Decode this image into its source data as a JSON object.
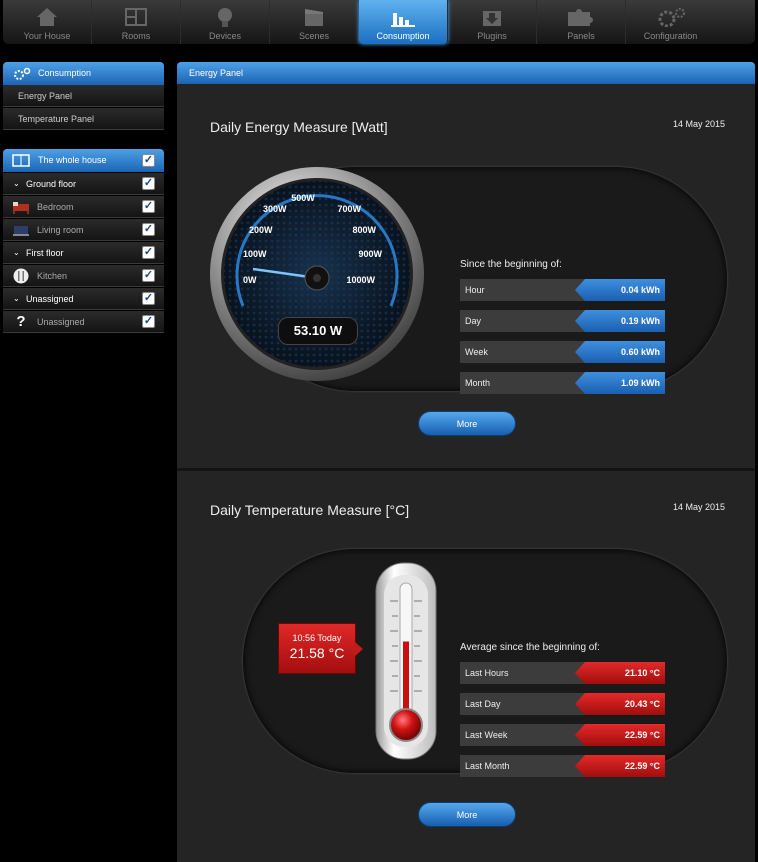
{
  "nav": {
    "tabs": [
      {
        "label": "Your House",
        "icon": "house-icon"
      },
      {
        "label": "Rooms",
        "icon": "rooms-icon"
      },
      {
        "label": "Devices",
        "icon": "bulb-icon"
      },
      {
        "label": "Scenes",
        "icon": "clapper-icon"
      },
      {
        "label": "Consumption",
        "icon": "bar-chart-icon",
        "active": true
      },
      {
        "label": "Plugins",
        "icon": "plugin-download-icon"
      },
      {
        "label": "Panels",
        "icon": "puzzle-icon"
      },
      {
        "label": "Configuration",
        "icon": "gears-icon"
      }
    ]
  },
  "sidebar": {
    "consumption": {
      "header": "Consumption",
      "items": [
        "Energy Panel",
        "Temperature Panel"
      ]
    },
    "house": {
      "header": "The whole house",
      "rows": [
        {
          "label": "Ground floor",
          "type": "group"
        },
        {
          "label": "Bedroom",
          "type": "room",
          "icon": "bed-icon"
        },
        {
          "label": "Living room",
          "type": "room",
          "icon": "sofa-icon"
        },
        {
          "label": "First floor",
          "type": "group"
        },
        {
          "label": "Kitchen",
          "type": "room",
          "icon": "cutlery-icon"
        },
        {
          "label": "Unassigned",
          "type": "group"
        },
        {
          "label": "Unassigned",
          "type": "room",
          "icon": "question-icon"
        }
      ]
    }
  },
  "main": {
    "header": "Energy Panel",
    "energy": {
      "title": "Daily Energy Measure [Watt]",
      "date": "14 May 2015",
      "gauge": {
        "labels": [
          "0W",
          "100W",
          "200W",
          "300W",
          "500W",
          "700W",
          "800W",
          "900W",
          "1000W"
        ],
        "reading": "53.10 W",
        "value_w": 53.1
      },
      "subtitle": "Since the beginning of:",
      "rows": [
        {
          "label": "Hour",
          "value": "0.04 kWh"
        },
        {
          "label": "Day",
          "value": "0.19 kWh"
        },
        {
          "label": "Week",
          "value": "0.60 kWh"
        },
        {
          "label": "Month",
          "value": "1.09 kWh"
        }
      ],
      "more": "More"
    },
    "temperature": {
      "title": "Daily Temperature Measure [°C]",
      "date": "14 May 2015",
      "now_time": "10:56 Today",
      "now_value": "21.58 °C",
      "thermo_level": 0.55,
      "subtitle": "Average since the beginning of:",
      "rows": [
        {
          "label": "Last Hours",
          "value": "21.10 °C"
        },
        {
          "label": "Last Day",
          "value": "20.43 °C"
        },
        {
          "label": "Last Week",
          "value": "22.59 °C"
        },
        {
          "label": "Last Month",
          "value": "22.59 °C"
        }
      ],
      "more": "More"
    }
  },
  "colors": {
    "accent_blue": "#2a7ed2",
    "alert_red": "#d01a1a"
  }
}
